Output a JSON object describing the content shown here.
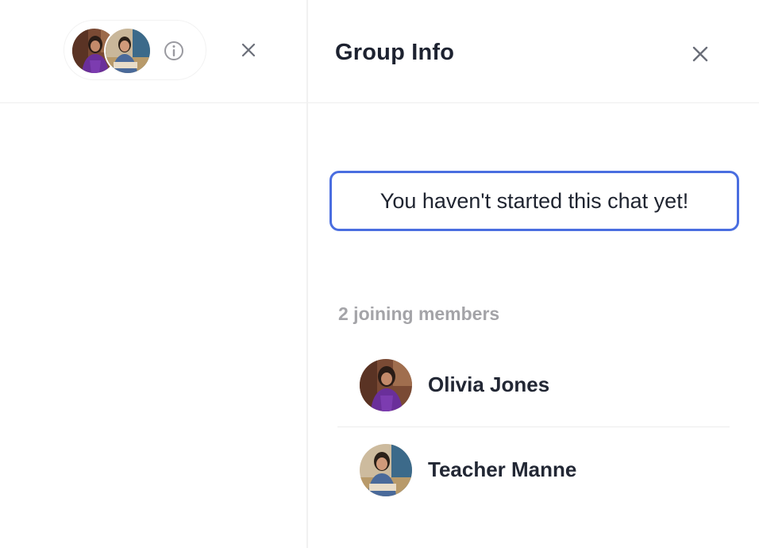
{
  "chat_header": {
    "participants": [
      {
        "avatar": "avatar-olivia-jones"
      },
      {
        "avatar": "avatar-teacher-manne"
      }
    ],
    "info_icon": "info-icon",
    "close_icon": "close-icon"
  },
  "group_info": {
    "title": "Group Info",
    "close_icon": "close-icon",
    "notice": "You haven't started this chat yet!",
    "notice_border_color": "#4a6ee0",
    "members_label": "2 joining members",
    "members": [
      {
        "name": "Olivia Jones",
        "avatar": "avatar-olivia-jones"
      },
      {
        "name": "Teacher Manne",
        "avatar": "avatar-teacher-manne"
      }
    ]
  }
}
